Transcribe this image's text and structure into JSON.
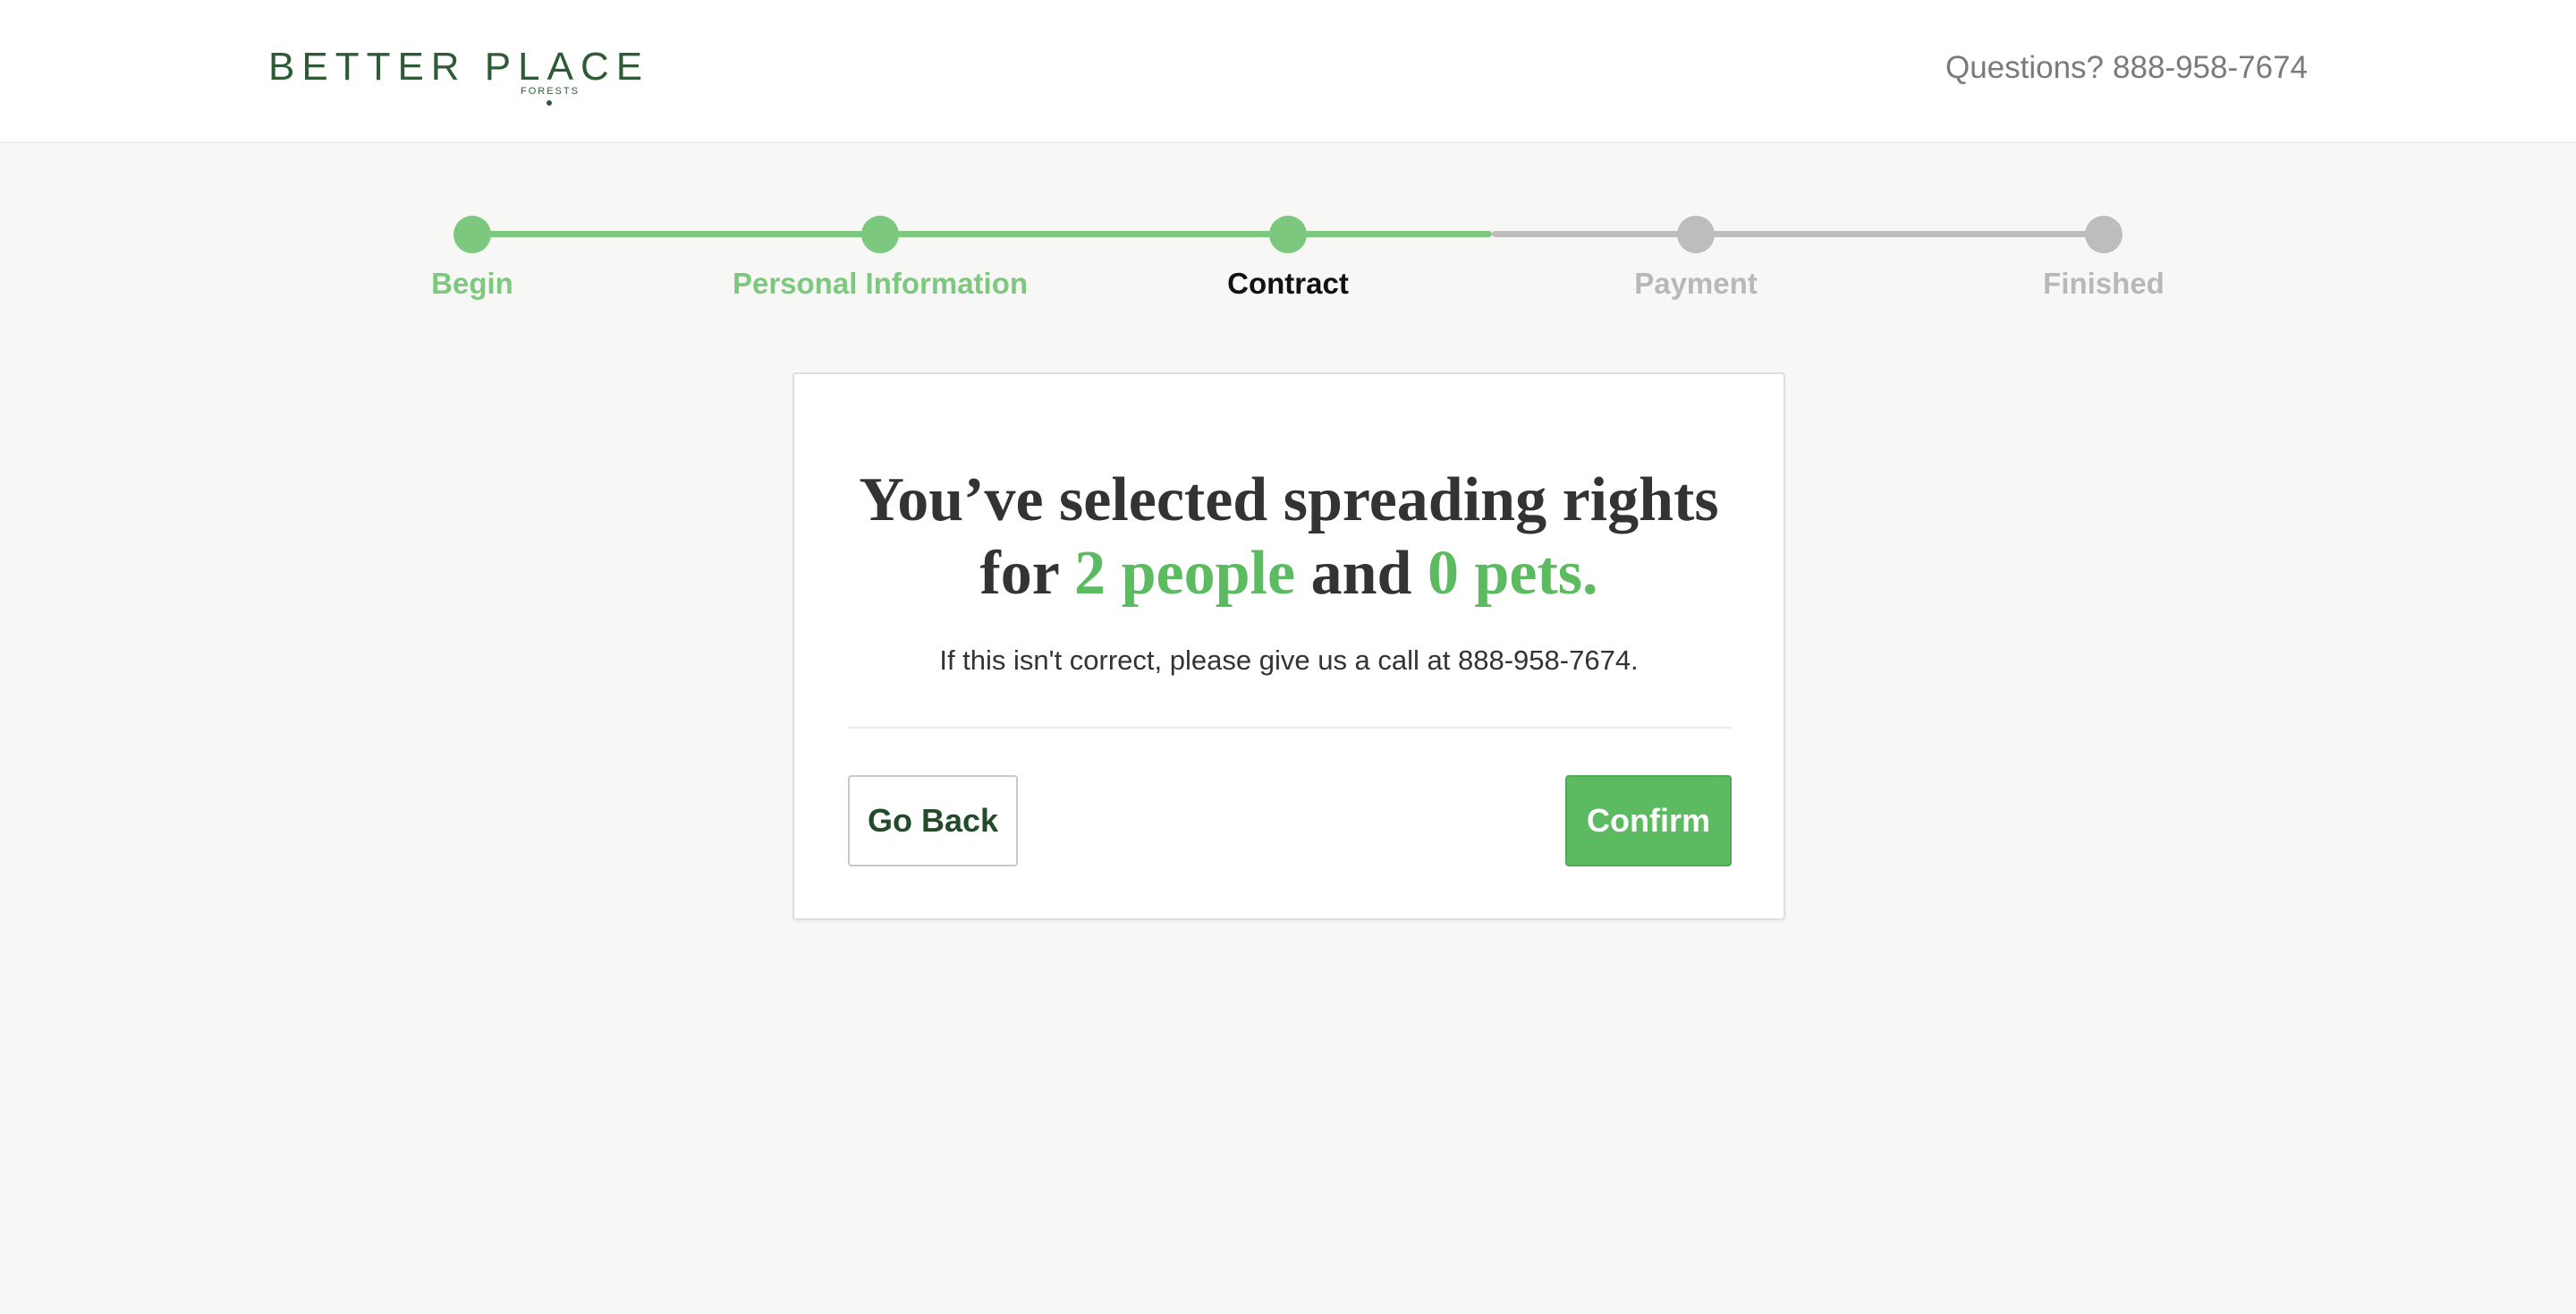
{
  "header": {
    "logo_text": "BETTER PLACE",
    "logo_sub": "FORESTS",
    "questions_label": "Questions?",
    "phone": "888-958-7674"
  },
  "stepper": {
    "steps": [
      {
        "label": "Begin",
        "state": "done"
      },
      {
        "label": "Personal Information",
        "state": "done"
      },
      {
        "label": "Contract",
        "state": "current"
      },
      {
        "label": "Payment",
        "state": "todo"
      },
      {
        "label": "Finished",
        "state": "todo"
      }
    ],
    "progress": 0.625
  },
  "card": {
    "headline_line1": "You’ve selected spreading rights",
    "headline_for": "for",
    "people": "2 people",
    "and": "and",
    "pets": "0 pets.",
    "subtext": "If this isn't correct, please give us a call at 888-958-7674.",
    "back_label": "Go Back",
    "confirm_label": "Confirm"
  },
  "colors": {
    "brand_green": "#2e5b35",
    "accent_green": "#5cba60",
    "step_done": "#7cc87f",
    "step_todo": "#bdbdbd"
  }
}
